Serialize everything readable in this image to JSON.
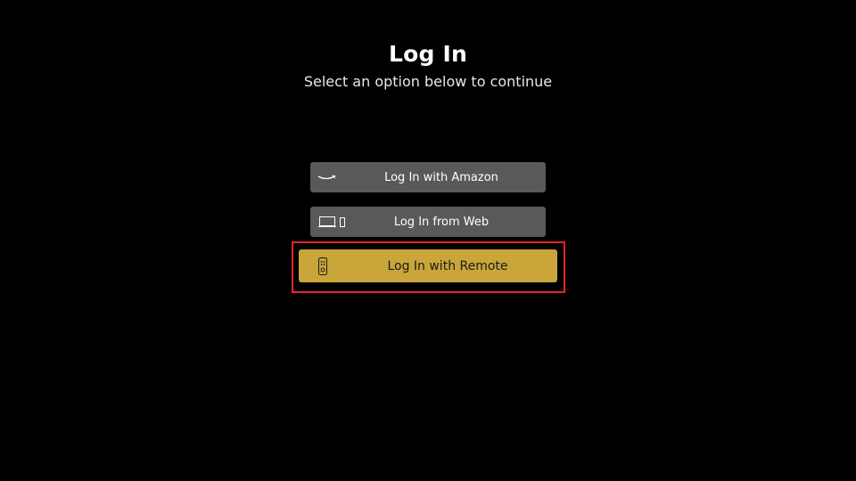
{
  "header": {
    "title": "Log In",
    "subtitle": "Select an option below to continue"
  },
  "options": [
    {
      "label": "Log In with Amazon",
      "icon": "amazon-smile-icon",
      "selected": false
    },
    {
      "label": "Log In from Web",
      "icon": "laptop-phone-icon",
      "selected": false
    },
    {
      "label": "Log In with Remote",
      "icon": "remote-icon",
      "selected": true
    }
  ],
  "colors": {
    "background": "#000000",
    "button": "#595959",
    "button_selected": "#c9a53a",
    "focus_ring": "#e0252b"
  }
}
